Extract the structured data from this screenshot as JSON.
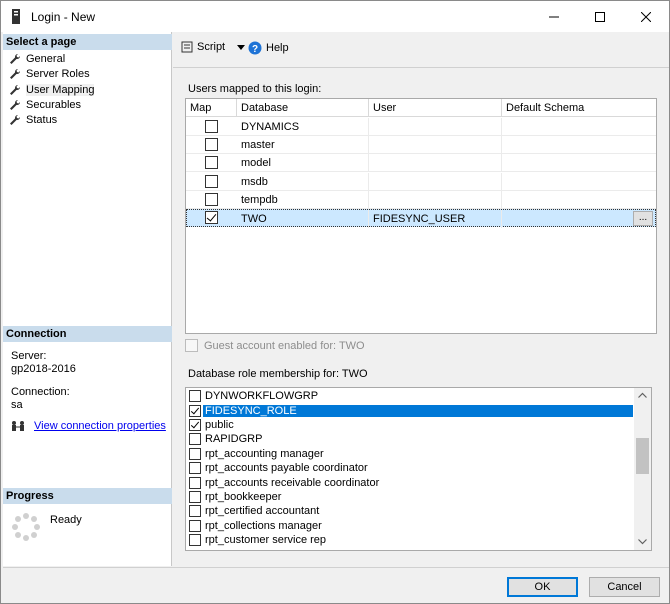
{
  "window": {
    "title": "Login - New"
  },
  "sidebar": {
    "select_page_header": "Select a page",
    "items": [
      {
        "label": "General"
      },
      {
        "label": "Server Roles"
      },
      {
        "label": "User Mapping"
      },
      {
        "label": "Securables"
      },
      {
        "label": "Status"
      }
    ],
    "connection_header": "Connection",
    "server_label": "Server:",
    "server_value": "gp2018-2016",
    "connection_label": "Connection:",
    "connection_value": "sa",
    "view_connection_link": "View connection properties",
    "progress_header": "Progress",
    "progress_status": "Ready"
  },
  "toolbar": {
    "script_label": "Script",
    "help_label": "Help"
  },
  "users_mapped": {
    "label": "Users mapped to this login:",
    "columns": [
      "Map",
      "Database",
      "User",
      "Default Schema"
    ],
    "rows": [
      {
        "checked": false,
        "database": "DYNAMICS",
        "user": "",
        "schema": ""
      },
      {
        "checked": false,
        "database": "master",
        "user": "",
        "schema": ""
      },
      {
        "checked": false,
        "database": "model",
        "user": "",
        "schema": ""
      },
      {
        "checked": false,
        "database": "msdb",
        "user": "",
        "schema": ""
      },
      {
        "checked": false,
        "database": "tempdb",
        "user": "",
        "schema": ""
      },
      {
        "checked": true,
        "database": "TWO",
        "user": "FIDESYNC_USER",
        "schema": "",
        "ellipsis": "..."
      }
    ]
  },
  "guest_account": {
    "label": "Guest account enabled for: TWO"
  },
  "role_membership": {
    "label": "Database role membership for: TWO",
    "roles": [
      {
        "checked": false,
        "name": "DYNWORKFLOWGRP"
      },
      {
        "checked": true,
        "name": "FIDESYNC_ROLE"
      },
      {
        "checked": true,
        "name": "public"
      },
      {
        "checked": false,
        "name": "RAPIDGRP"
      },
      {
        "checked": false,
        "name": "rpt_accounting manager"
      },
      {
        "checked": false,
        "name": "rpt_accounts payable coordinator"
      },
      {
        "checked": false,
        "name": "rpt_accounts receivable coordinator"
      },
      {
        "checked": false,
        "name": "rpt_bookkeeper"
      },
      {
        "checked": false,
        "name": "rpt_certified accountant"
      },
      {
        "checked": false,
        "name": "rpt_collections manager"
      },
      {
        "checked": false,
        "name": "rpt_customer service rep"
      }
    ]
  },
  "buttons": {
    "ok": "OK",
    "cancel": "Cancel"
  },
  "colors": {
    "section_header": "#c9dcec",
    "selection": "#0078d7",
    "row_selection": "#cce8ff"
  }
}
